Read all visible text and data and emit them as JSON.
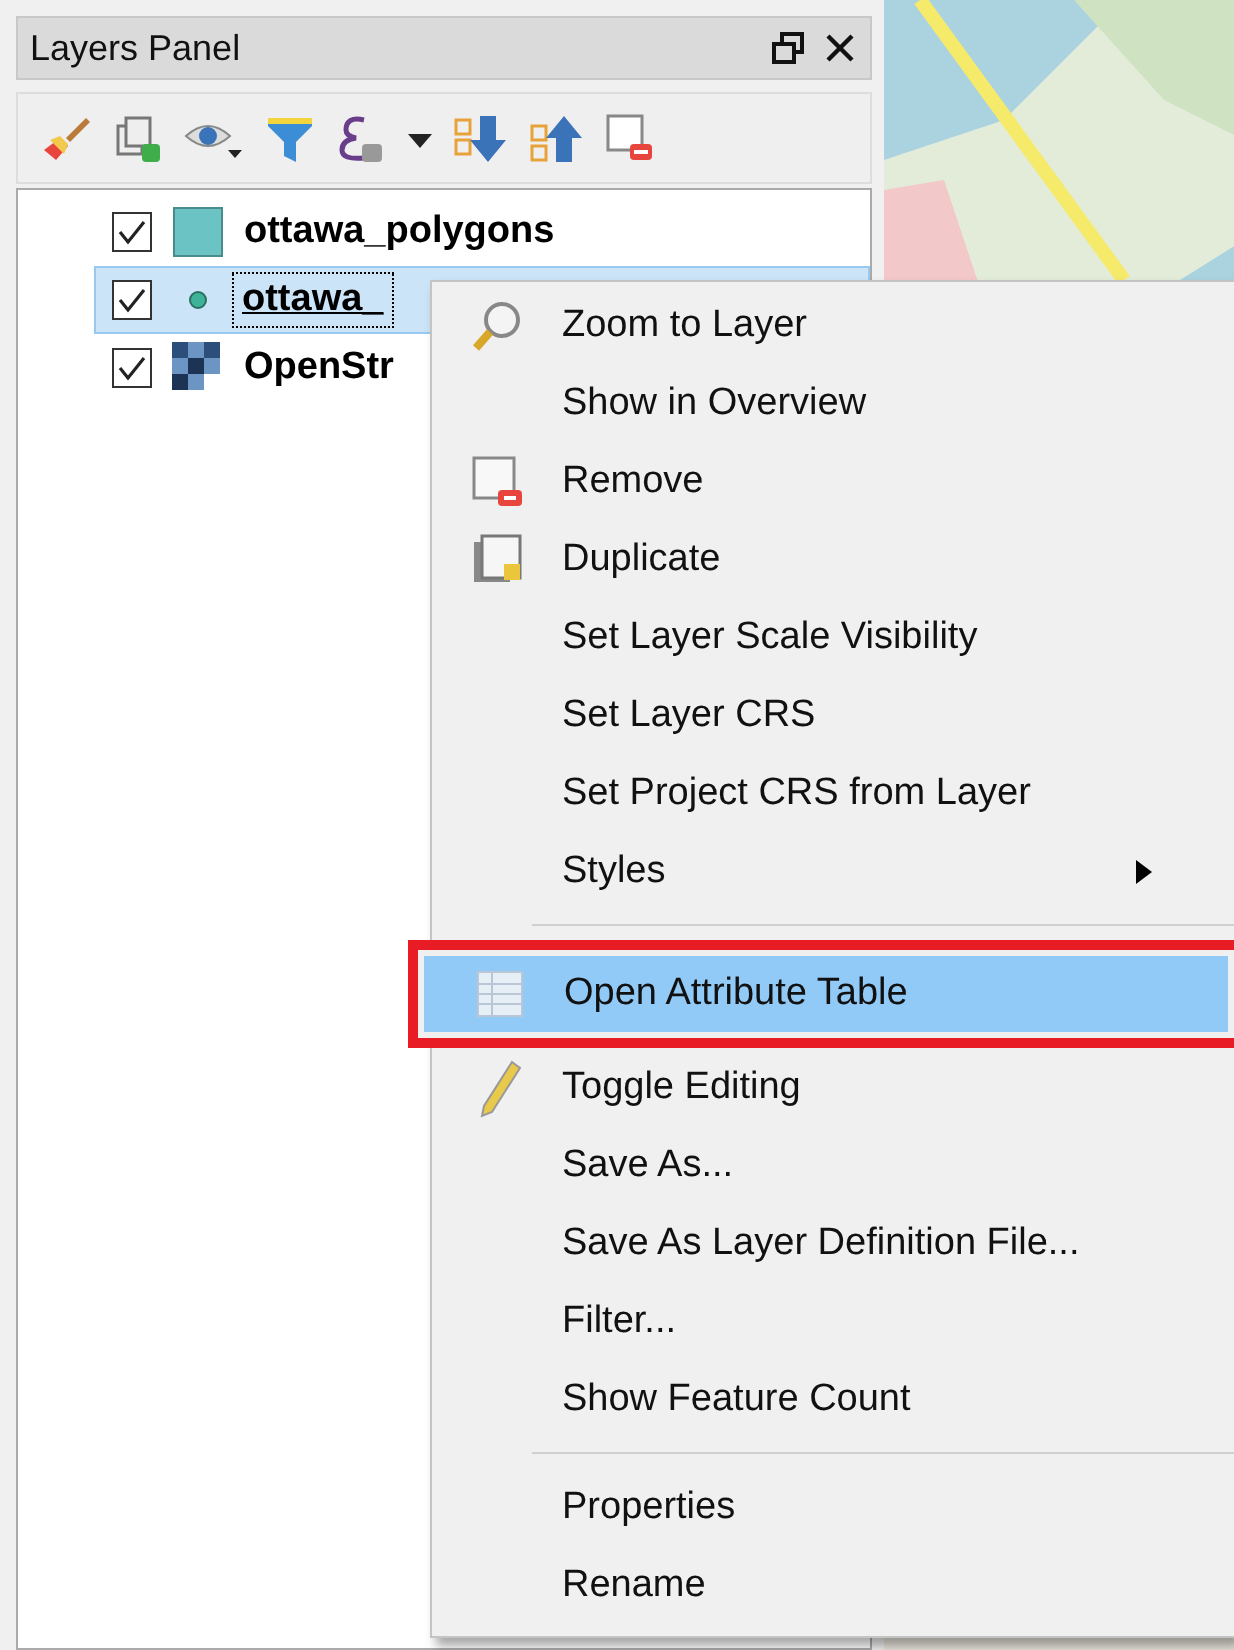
{
  "panel": {
    "title": "Layers Panel"
  },
  "layers": [
    {
      "name": "ottawa_polygons",
      "kind": "polygon",
      "checked": true,
      "selected": false
    },
    {
      "name": "ottawa_",
      "kind": "point",
      "checked": true,
      "selected": true
    },
    {
      "name": "OpenStr",
      "kind": "raster",
      "checked": true,
      "selected": false
    }
  ],
  "context_menu": {
    "sections": [
      [
        {
          "label": "Zoom to Layer",
          "submenu": false,
          "selected": false
        },
        {
          "label": "Show in Overview",
          "submenu": false,
          "selected": false
        },
        {
          "label": "Remove",
          "submenu": false,
          "selected": false
        },
        {
          "label": "Duplicate",
          "submenu": false,
          "selected": false
        },
        {
          "label": "Set Layer Scale Visibility",
          "submenu": false,
          "selected": false
        },
        {
          "label": "Set Layer CRS",
          "submenu": false,
          "selected": false
        },
        {
          "label": "Set Project CRS from Layer",
          "submenu": false,
          "selected": false
        },
        {
          "label": "Styles",
          "submenu": true,
          "selected": false
        }
      ],
      [
        {
          "label": "Open Attribute Table",
          "submenu": false,
          "selected": true
        },
        {
          "label": "Toggle Editing",
          "submenu": false,
          "selected": false
        },
        {
          "label": "Save As...",
          "submenu": false,
          "selected": false
        },
        {
          "label": "Save As Layer Definition File...",
          "submenu": false,
          "selected": false
        },
        {
          "label": "Filter...",
          "submenu": false,
          "selected": false
        },
        {
          "label": "Show Feature Count",
          "submenu": false,
          "selected": false
        }
      ],
      [
        {
          "label": "Properties",
          "submenu": false,
          "selected": false
        },
        {
          "label": "Rename",
          "submenu": false,
          "selected": false
        }
      ]
    ]
  }
}
